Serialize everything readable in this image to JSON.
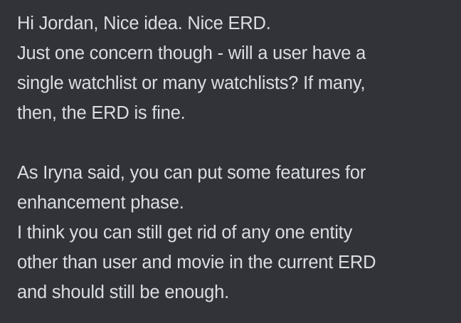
{
  "message": {
    "lines": [
      "Hi Jordan, Nice idea. Nice ERD.",
      "Just one concern though - will a user have a",
      "single watchlist or many watchlists? If many,",
      "then, the ERD is fine.",
      "",
      "As Iryna said, you can put some features for",
      "enhancement phase.",
      "I think you can still get rid of any one entity",
      "other than user and movie in the current ERD",
      "and should still be enough."
    ]
  }
}
